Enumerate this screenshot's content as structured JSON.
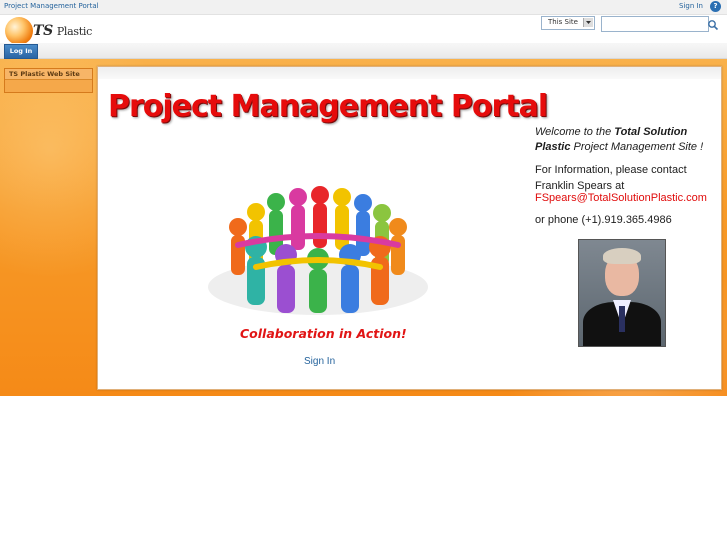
{
  "topbar": {
    "site_title": "Project Management Portal",
    "sign_in": "Sign In",
    "help_glyph": "?"
  },
  "header": {
    "logo_ts": "TS",
    "logo_plastic": "Plastic",
    "scope_selected": "This Site",
    "search_placeholder": ""
  },
  "nav": {
    "tab_label": "Log In"
  },
  "quicklaunch": {
    "items": [
      {
        "label": "TS Plastic Web Site"
      }
    ]
  },
  "main": {
    "banner_title": "Project Management Portal",
    "tagline": "Collaboration in Action!",
    "sign_in_link": "Sign In",
    "welcome_prefix": "Welcome to the ",
    "welcome_bold1": "Total Solution",
    "welcome_bold2": "Plastic",
    "welcome_suffix": " Project Management Site !",
    "contact_text": "For Information, please contact Franklin Spears at",
    "email": "FSpears@TotalSolutionPlastic.com",
    "phone": "or phone (+1).919.365.4986"
  },
  "colors": {
    "accent_orange": "#f79a28",
    "brand_red": "#e60c0c",
    "link_blue": "#26649d"
  },
  "icons": [
    "help-icon",
    "search-icon",
    "dropdown-arrow-icon"
  ]
}
